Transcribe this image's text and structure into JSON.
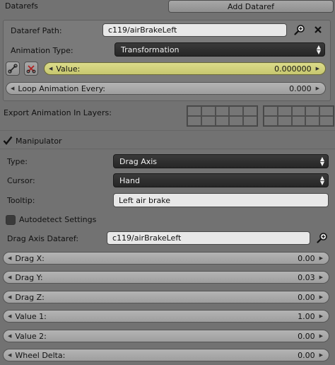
{
  "datarefs": {
    "title": "Datarefs",
    "add_button": "Add Dataref",
    "path_label": "Dataref Path:",
    "path_value": "c119/airBrakeLeft",
    "anim_type_label": "Animation Type:",
    "anim_type_value": "Transformation",
    "value_label": "Value:",
    "value_value": "0.000000",
    "loop_label": "Loop Animation Every:",
    "loop_value": "0.000"
  },
  "export": {
    "label": "Export Animation In Layers:"
  },
  "manipulator": {
    "title": "Manipulator",
    "enabled": true,
    "type_label": "Type:",
    "type_value": "Drag Axis",
    "cursor_label": "Cursor:",
    "cursor_value": "Hand",
    "tooltip_label": "Tooltip:",
    "tooltip_value": "Left air brake",
    "autodetect_label": "Autodetect Settings",
    "autodetect_checked": false,
    "drag_axis_label": "Drag Axis Dataref:",
    "drag_axis_value": "c119/airBrakeLeft",
    "fields": [
      {
        "label": "Drag X:",
        "value": "0.00"
      },
      {
        "label": "Drag Y:",
        "value": "0.03"
      },
      {
        "label": "Drag Z:",
        "value": "0.00"
      },
      {
        "label": "Value 1:",
        "value": "1.00"
      },
      {
        "label": "Value 2:",
        "value": "0.00"
      },
      {
        "label": "Wheel Delta:",
        "value": "0.00"
      }
    ]
  },
  "icons": [
    "search-icon",
    "close-icon",
    "link-icon",
    "scissors-icon",
    "checkmark-icon"
  ]
}
